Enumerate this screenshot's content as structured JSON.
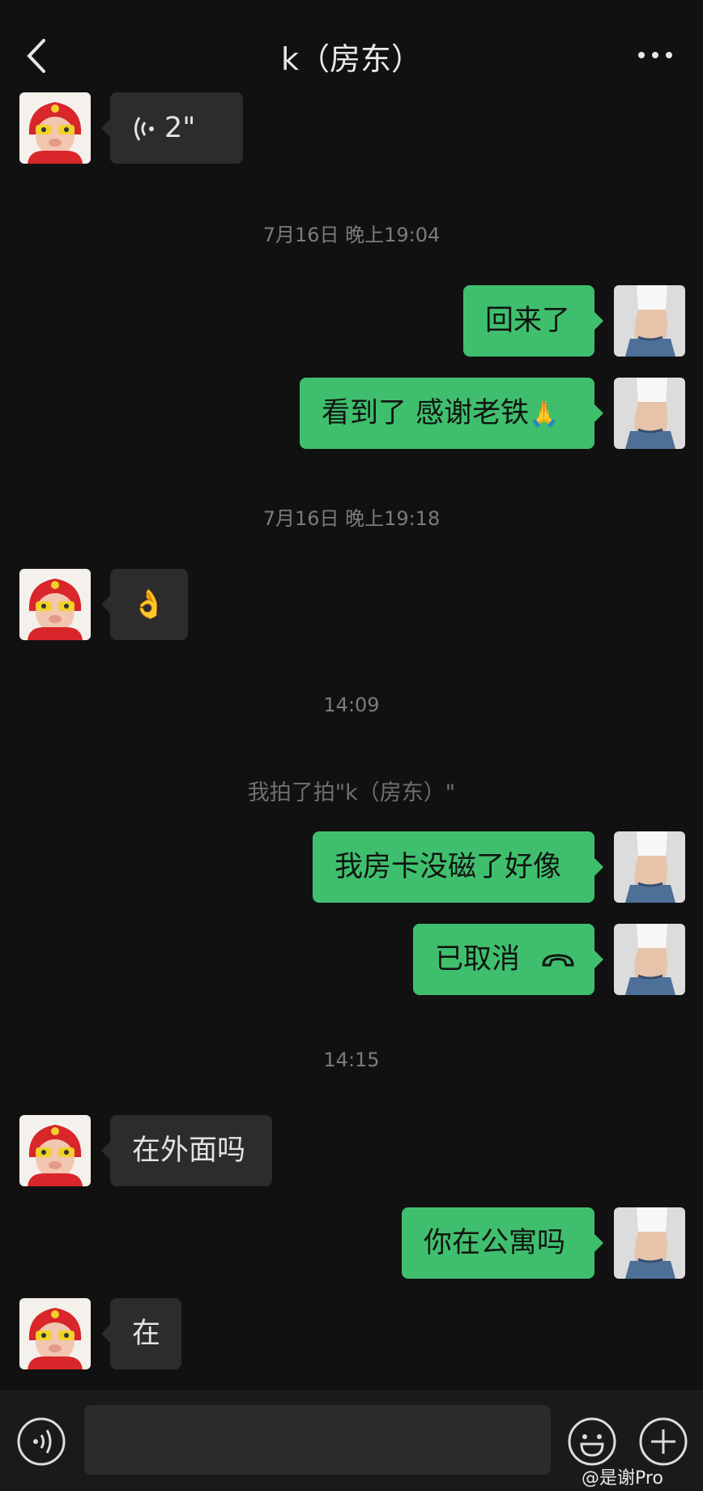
{
  "header": {
    "title": "k（房东）",
    "back_icon": "chevron-left-icon",
    "more_icon": "more-dots-icon"
  },
  "messages": [
    {
      "side": "in",
      "type": "voice",
      "duration": "2\""
    },
    {
      "type": "timestamp",
      "text": "7月16日 晚上19:04"
    },
    {
      "side": "out",
      "text": "回来了"
    },
    {
      "side": "out",
      "text": "看到了 感谢老铁",
      "emoji": "🙏"
    },
    {
      "type": "timestamp",
      "text": "7月16日 晚上19:18"
    },
    {
      "side": "in",
      "type": "emoji",
      "emoji": "👌"
    },
    {
      "type": "timestamp",
      "text": "14:09"
    },
    {
      "type": "system",
      "text": "我拍了拍\"k（房东）\""
    },
    {
      "side": "out",
      "text": "我房卡没磁了好像"
    },
    {
      "side": "out",
      "type": "call",
      "text": "已取消",
      "icon": "phone-hangup-icon"
    },
    {
      "type": "timestamp",
      "text": "14:15"
    },
    {
      "side": "in",
      "text": "在外面吗"
    },
    {
      "side": "out",
      "text": "你在公寓吗"
    },
    {
      "side": "in",
      "text": "在"
    }
  ],
  "input_bar": {
    "placeholder": "",
    "voice_icon": "voice-toggle-icon",
    "emoji_icon": "emoji-smile-icon",
    "plus_icon": "plus-circle-icon"
  },
  "watermark": "@是谢Pro",
  "colors": {
    "background": "#111111",
    "bubble_in": "#2c2c2c",
    "bubble_out": "#3fbf6e",
    "timestamp": "#7c7c7c"
  }
}
